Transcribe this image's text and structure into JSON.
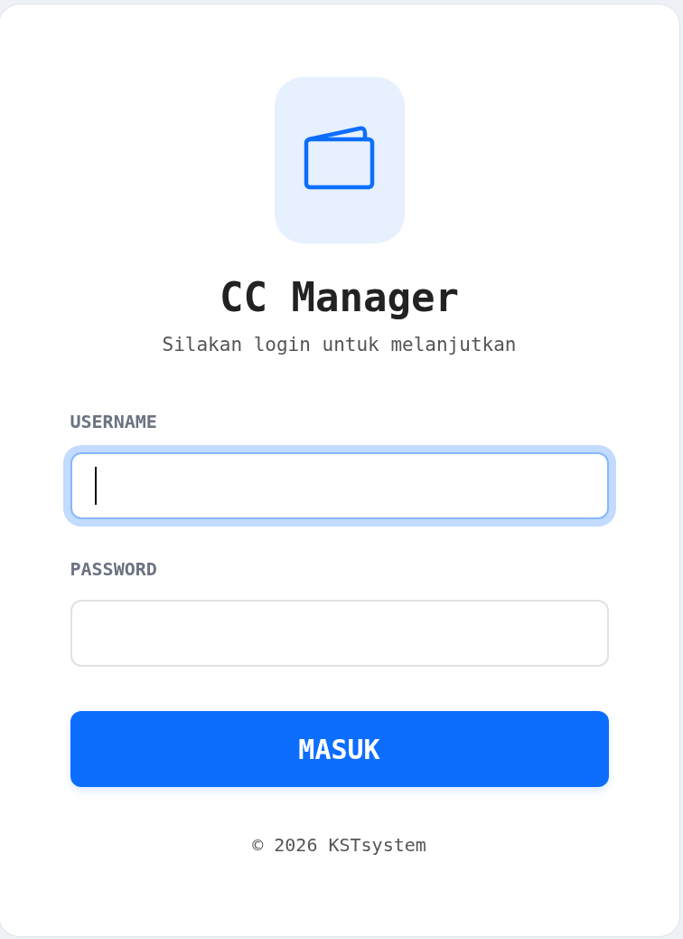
{
  "app": {
    "title": "CC Manager",
    "subtitle": "Silakan login untuk melanjutkan"
  },
  "fields": [
    {
      "label": "USERNAME",
      "focused": true
    },
    {
      "label": "PASSWORD",
      "focused": false
    }
  ],
  "submit": {
    "label": "MASUK"
  },
  "footer": "© 2026 KSTsystem"
}
